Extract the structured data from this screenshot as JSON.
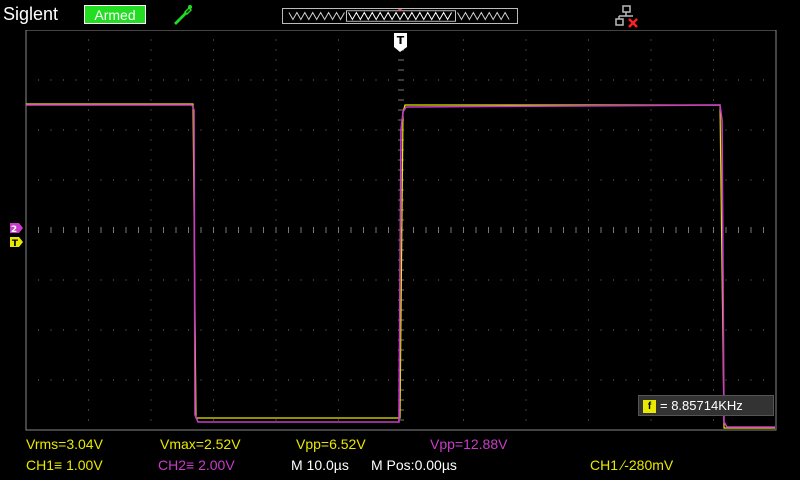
{
  "header": {
    "brand": "Siglent",
    "status": "Armed",
    "status_color": "#22dd22",
    "icons": [
      "probe-icon",
      "network-disconnected-icon"
    ]
  },
  "markers": {
    "trigger_position_label": "T",
    "ch2_marker": "2",
    "trigger_level_label": "T"
  },
  "channels": {
    "ch1": {
      "color": "#e8e800"
    },
    "ch2": {
      "color": "#c83cc8"
    }
  },
  "frequency": {
    "badge": "f",
    "text": "= 8.85714KHz"
  },
  "measurements": {
    "vrms": "Vrms=3.04V",
    "vmax": "Vmax=2.52V",
    "vpp_ch1": "Vpp=6.52V",
    "vpp_ch2": "Vpp=12.88V"
  },
  "settings": {
    "ch1_scale": "CH1≡ 1.00V",
    "ch2_scale": "CH2≡ 2.00V",
    "timebase": "M 10.0µs",
    "mpos": "M Pos:0.00µs",
    "trigger": "CH1 ∕-280mV"
  }
}
